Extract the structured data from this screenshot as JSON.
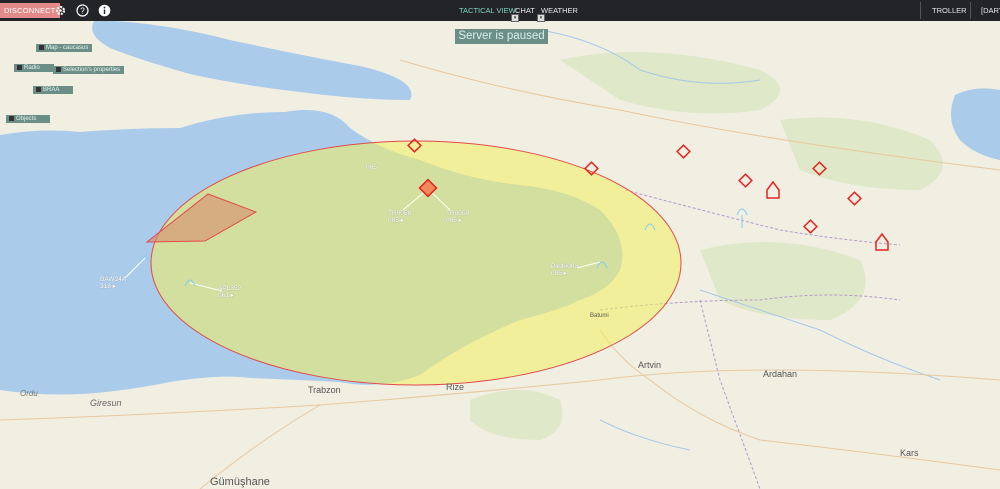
{
  "toolbar": {
    "disconnect_label": "DISCONNECT",
    "tabs": [
      {
        "label": "TACTICAL VIEW",
        "active": true
      },
      {
        "label": "CHAT",
        "active": false
      },
      {
        "label": "WEATHER",
        "active": false
      }
    ],
    "user_label": "TROLLER",
    "extra_label": "[DART"
  },
  "status_banner": "Server is paused",
  "panels": [
    {
      "label": "Map - caucasus"
    },
    {
      "label": "Radio"
    },
    {
      "label": "Selection's properties"
    },
    {
      "label": "BRAA"
    },
    {
      "label": "Objects"
    }
  ],
  "map": {
    "place_names": [
      "Giresun",
      "Trabzon",
      "Rize",
      "Artvin",
      "Ardahan",
      "Kars",
      "Gümüşhane",
      "Ordu",
      "Batumi"
    ],
    "units": [
      {
        "callsign": "BAW24A",
        "value": "318"
      },
      {
        "callsign": "AAL352",
        "value": "061"
      },
      {
        "callsign": "TR0058",
        "value": "005"
      },
      {
        "callsign": "TR0059",
        "value": "005"
      },
      {
        "callsign": "Pilot#003",
        "value": "005"
      },
      {
        "callsign": "",
        "value": "005"
      }
    ],
    "colors": {
      "sea": "#aacbea",
      "land": "#f2efe3",
      "range_fill": "#f2f05f",
      "range_stroke": "#e34a4a",
      "sam_red": "#e82323",
      "friendly_cyan": "#88ccee"
    }
  }
}
